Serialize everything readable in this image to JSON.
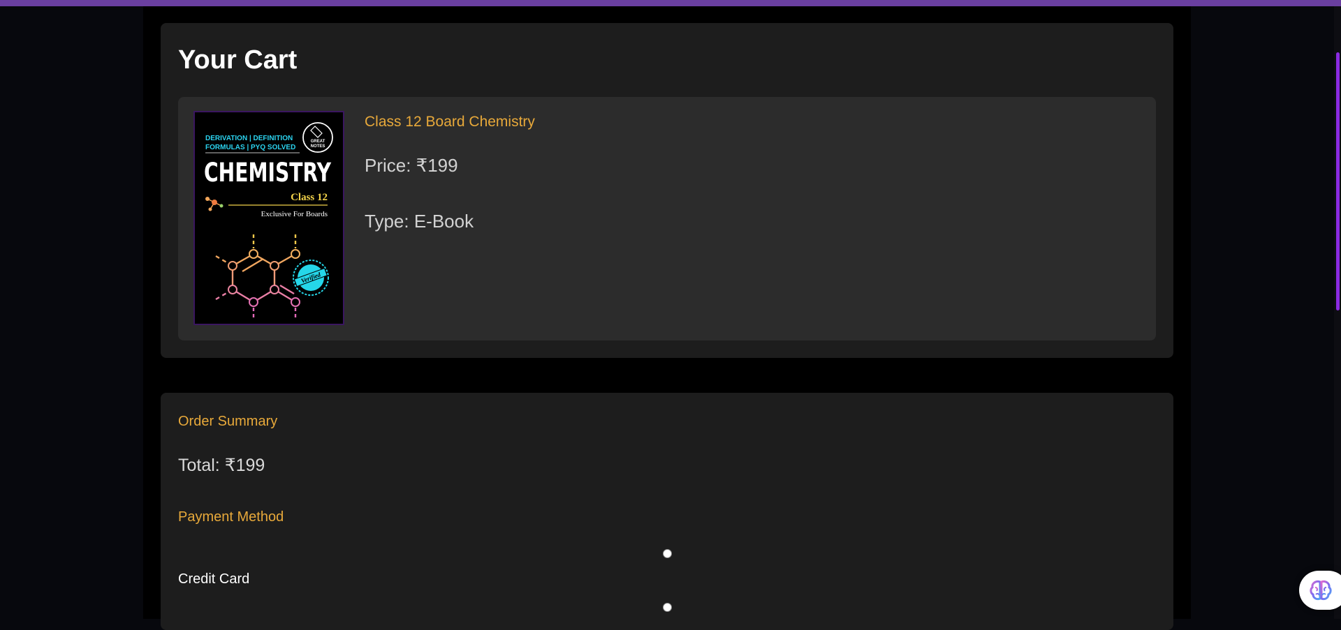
{
  "cart": {
    "title": "Your Cart",
    "item": {
      "name": "Class 12 Board Chemistry",
      "price": "Price: ₹199",
      "type": "Type: E-Book",
      "cover": {
        "tagline_line1": "DERIVATION | DEFINITION",
        "tagline_line2": "FORMULAS | PYQ SOLVED",
        "title": "CHEMISTRY",
        "class": "Class 12",
        "subtitle": "Exclusive For Boards",
        "logo_line1": "GREAT",
        "logo_line2": "NOTES",
        "stamp": "Verified"
      }
    }
  },
  "summary": {
    "heading": "Order Summary",
    "total": "Total: ₹199",
    "payment_heading": "Payment Method",
    "payment_options": [
      {
        "label": "Credit Card",
        "selected": false
      },
      {
        "label": "",
        "selected": false
      }
    ]
  },
  "icons": {
    "assistant": "brain-icon"
  },
  "colors": {
    "accent": "#e8a93a",
    "top_bar": "#6a3fa0",
    "scrollbar": "#8a2be2"
  }
}
